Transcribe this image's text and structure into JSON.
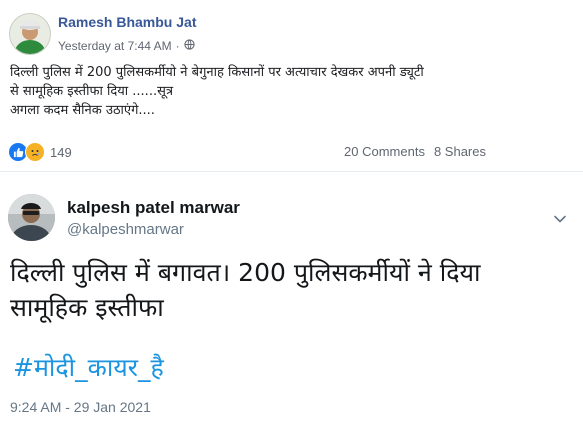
{
  "facebook_post": {
    "author": "Ramesh Bhambu Jat",
    "timestamp": "Yesterday at 7:44 AM",
    "separator": "·",
    "privacy_icon": "globe-icon",
    "text_lines": [
      "दिल्ली पुलिस में 200 पुलिसकर्मीयो ने बेगुनाह किसानों पर अत्याचार देखकर अपनी ड्यूटी",
      "से सामूहिक इस्तीफा दिया ......सूत्र",
      "अगला कदम सैनिक उठाएंगे...."
    ],
    "reactions": {
      "icons": [
        "like-icon",
        "sad-icon"
      ],
      "count": "149"
    },
    "comments": "20 Comments",
    "shares": "8 Shares"
  },
  "tweet": {
    "display_name": "kalpesh patel marwar",
    "handle": "@kalpeshmarwar",
    "menu_icon": "chevron-down-icon",
    "text_lines": [
      "दिल्ली पुलिस में बगावत। 200 पुलिसकर्मीयों ने दिया",
      "सामूहिक इस्तीफा"
    ],
    "hashtag": "#मोदी_कायर_है",
    "time": "9:24 AM - 29 Jan 2021"
  },
  "colors": {
    "fb_link": "#385898",
    "fb_meta": "#616770",
    "fb_like": "#1877f2",
    "fb_sad": "#f7b125",
    "tw_text": "#14171a",
    "tw_secondary": "#657786",
    "tw_hashtag": "#1b95e0"
  }
}
